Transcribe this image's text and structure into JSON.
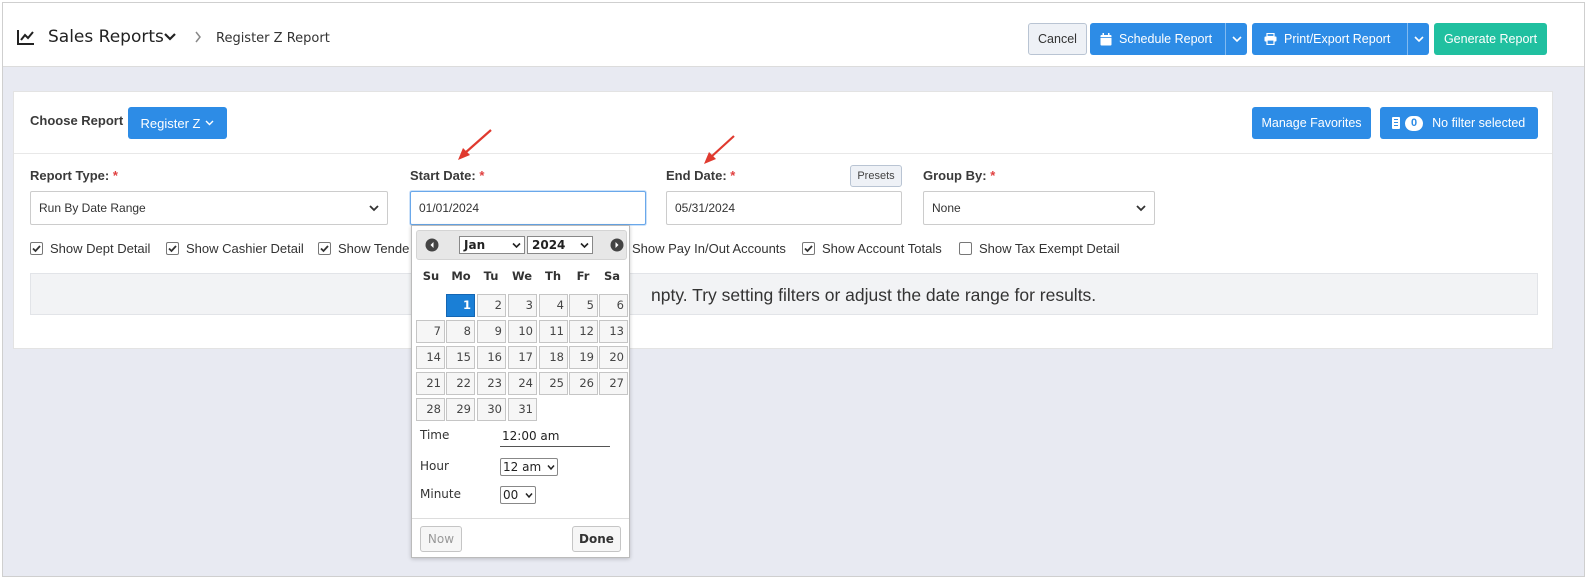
{
  "header": {
    "title": "Sales Reports",
    "subtitle": "Register Z Report",
    "cancel_label": "Cancel",
    "schedule_label": "Schedule Report",
    "print_label": "Print/Export Report",
    "generate_label": "Generate Report"
  },
  "report": {
    "choose_label": "Choose Report",
    "selected": "Register Z",
    "manage_favorites": "Manage Favorites",
    "filter_count": "0",
    "filter_label": "No filter selected"
  },
  "fields": {
    "report_type_label": "Report Type:",
    "report_type_value": "Run By Date Range",
    "start_label": "Start Date:",
    "start_value": "01/01/2024",
    "end_label": "End Date:",
    "end_value": "05/31/2024",
    "presets_label": "Presets",
    "group_label": "Group By:",
    "group_value": "None",
    "required_mark": "*"
  },
  "checks": [
    {
      "label": "Show Dept Detail",
      "checked": true
    },
    {
      "label": "Show Cashier Detail",
      "checked": true
    },
    {
      "label": "Show Tende",
      "checked": true
    },
    {
      "label": "Show Pay In/Out Accounts",
      "checked": false
    },
    {
      "label": "Show Account Totals",
      "checked": true
    },
    {
      "label": "Show Tax Exempt Detail",
      "checked": false
    }
  ],
  "empty_message": "npty. Try setting filters or adjust the date range for results.",
  "datepicker": {
    "month": "Jan",
    "year": "2024",
    "dow": [
      "Su",
      "Mo",
      "Tu",
      "We",
      "Th",
      "Fr",
      "Sa"
    ],
    "days": [
      "1",
      "2",
      "3",
      "4",
      "5",
      "6",
      "7",
      "8",
      "9",
      "10",
      "11",
      "12",
      "13",
      "14",
      "15",
      "16",
      "17",
      "18",
      "19",
      "20",
      "21",
      "22",
      "23",
      "24",
      "25",
      "26",
      "27",
      "28",
      "29",
      "30",
      "31"
    ],
    "selected_day": "1",
    "time_label": "Time",
    "time_value": "12:00 am",
    "hour_label": "Hour",
    "hour_value": "12 am",
    "minute_label": "Minute",
    "minute_value": "00",
    "now_label": "Now",
    "done_label": "Done"
  },
  "colors": {
    "primary": "#2d8ce6",
    "teal": "#20c0a0",
    "required": "#e04040",
    "arrow": "#e03a2f"
  }
}
